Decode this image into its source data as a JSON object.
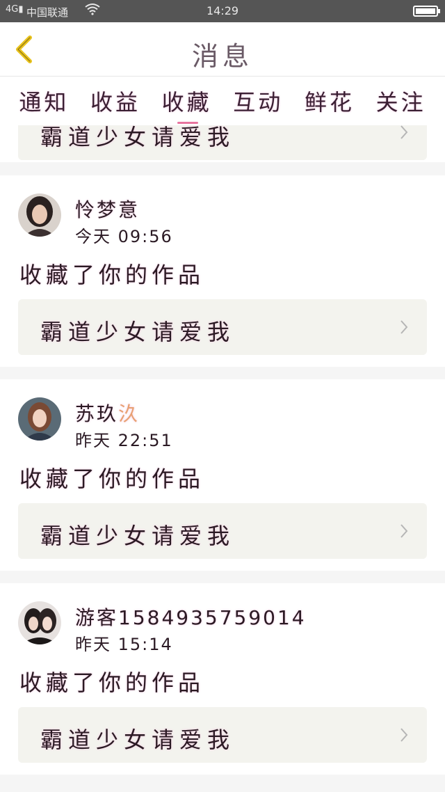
{
  "status_bar": {
    "network": "4G",
    "carrier": "中国联通",
    "time": "14:29"
  },
  "header": {
    "title": "消息",
    "back_icon": "chevron-left-icon"
  },
  "tabs": [
    {
      "label": "通知",
      "active": false
    },
    {
      "label": "收益",
      "active": false
    },
    {
      "label": "收藏",
      "active": true
    },
    {
      "label": "互动",
      "active": false
    },
    {
      "label": "鲜花",
      "active": false
    },
    {
      "label": "关注",
      "active": false
    }
  ],
  "colors": {
    "active_tab_underline": "#e8749f",
    "back_arrow": "#e8c21c",
    "username_accent": "#e8a071"
  },
  "partial_item": {
    "work_title": "霸道少女请爱我"
  },
  "messages": [
    {
      "username": "怜梦意",
      "username_accent": "",
      "time": "今天 09:56",
      "action": "收藏了你的作品",
      "work_title": "霸道少女请爱我"
    },
    {
      "username": "苏玖",
      "username_accent": "汣",
      "time": "昨天 22:51",
      "action": "收藏了你的作品",
      "work_title": "霸道少女请爱我"
    },
    {
      "username": "游客1584935759014",
      "username_accent": "",
      "time": "昨天 15:14",
      "action": "收藏了你的作品",
      "work_title": "霸道少女请爱我"
    }
  ]
}
